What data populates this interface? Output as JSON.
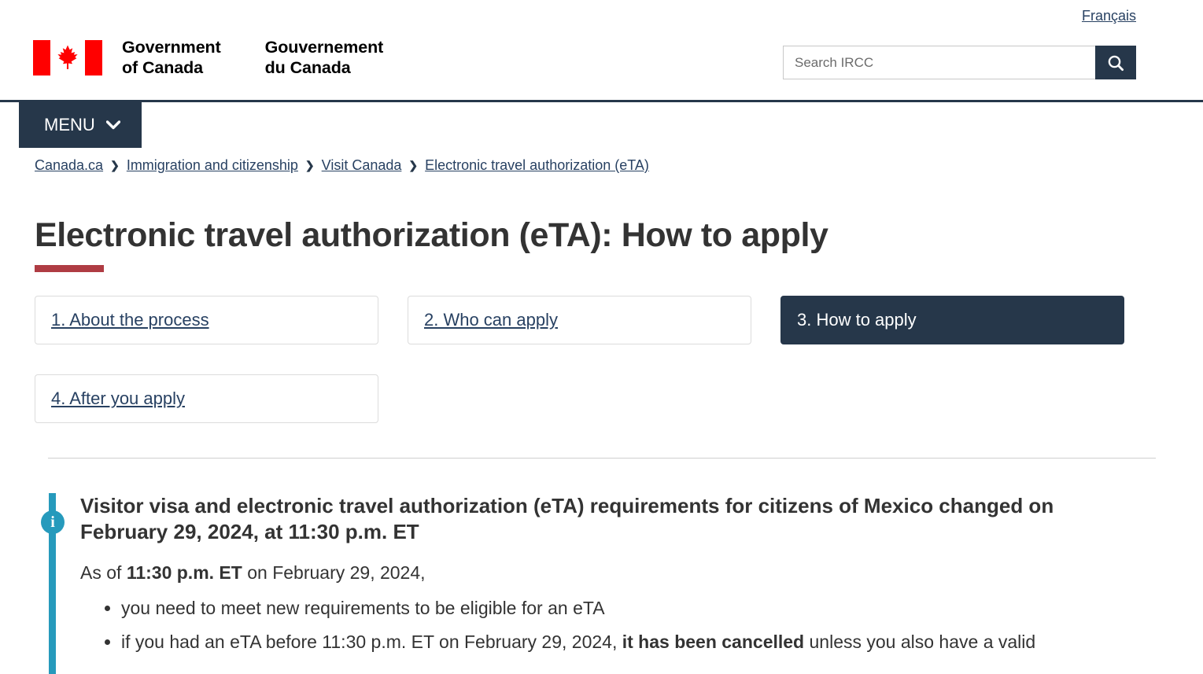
{
  "header": {
    "language_link": "Français",
    "brand": {
      "en_line1": "Government",
      "en_line2": "of Canada",
      "fr_line1": "Gouvernement",
      "fr_line2": "du Canada",
      "flag_icon": "canada-flag-icon"
    },
    "search": {
      "placeholder": "Search IRCC",
      "value": "",
      "button_icon": "search-icon"
    }
  },
  "menu": {
    "label": "MENU",
    "icon": "chevron-down-icon"
  },
  "breadcrumb": {
    "separator": "❯",
    "items": [
      {
        "label": "Canada.ca"
      },
      {
        "label": "Immigration and citizenship"
      },
      {
        "label": "Visit Canada"
      },
      {
        "label": "Electronic travel authorization (eTA)"
      }
    ]
  },
  "main": {
    "title": "Electronic travel authorization (eTA): How to apply",
    "steps": [
      {
        "label": "1. About the process",
        "current": false
      },
      {
        "label": "2. Who can apply",
        "current": false
      },
      {
        "label": "3. How to apply",
        "current": true
      },
      {
        "label": "4. After you apply",
        "current": false
      }
    ]
  },
  "alert": {
    "icon": "info-icon",
    "icon_glyph": "i",
    "title": "Visitor visa and electronic travel authorization (eTA) requirements for citizens of Mexico changed on February 29, 2024, at 11:30 p.m. ET",
    "intro": {
      "before": "As of ",
      "bold": "11:30 p.m. ET",
      "after": " on February 29, 2024,"
    },
    "bullets": [
      {
        "before": "you need to meet new requirements to be eligible for an eTA",
        "bold": "",
        "after": ""
      },
      {
        "before": "if you had an eTA before 11:30 p.m. ET on February 29, 2024, ",
        "bold": "it has been cancelled",
        "after": " unless you also have a valid"
      }
    ]
  },
  "colors": {
    "navy": "#26374a",
    "link": "#284162",
    "accent_red": "#af3c43",
    "alert_teal": "#269abc",
    "flag_red": "#ff0000"
  }
}
